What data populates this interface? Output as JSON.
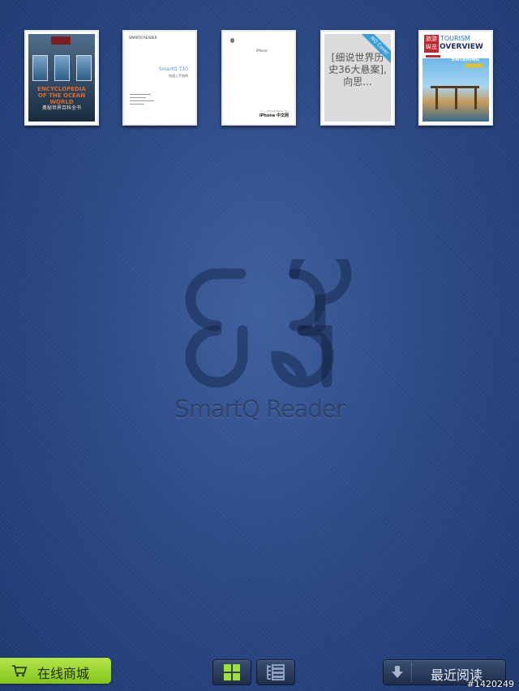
{
  "books": [
    {
      "id_label": "book-1",
      "title_lines": [
        "ENCYCLOPEDIA",
        "OF THE OCEAN WORLD"
      ],
      "subtitle": "奥秘世界百科全书"
    },
    {
      "id_label": "book-2",
      "header": "SMARTQ READER",
      "title": "SmartQ T10",
      "subtitle": "快速上手指南"
    },
    {
      "id_label": "book-3",
      "small": "iPhone",
      "brand": "iPhone 中文网",
      "url": "iPhone.tgbus.com"
    },
    {
      "id_label": "book-4",
      "cover_text": "[细说世界历史36大悬案],向思...",
      "ribbon": "NO Cover"
    },
    {
      "id_label": "book-5",
      "masthead": "旅游纵览",
      "title_top": "TOURISM",
      "title_main": "OVERVIEW",
      "cover_line": "ENTERING"
    }
  ],
  "logo": {
    "text": "SmartQ Reader"
  },
  "toolbar": {
    "store_label": "在线商城",
    "recent_label": "最近阅读"
  },
  "watermark": "#1420249",
  "colors": {
    "background": "#2c4a86",
    "store_green": "#9ee233",
    "grid_icon_green": "#9ee233"
  },
  "icons": {
    "store": "cart-icon",
    "grid": "grid-view-icon",
    "list": "list-view-icon",
    "recent": "download-arrow-icon"
  }
}
